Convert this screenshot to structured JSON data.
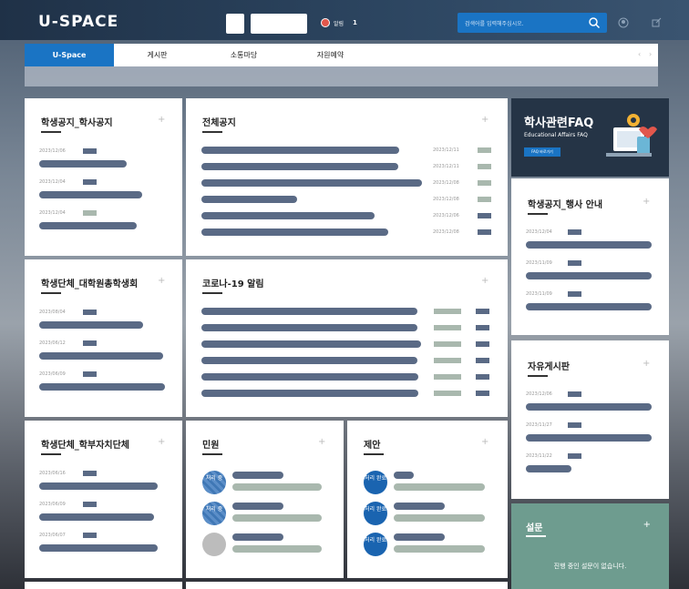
{
  "header": {
    "logo": "U-SPACE",
    "alarm_label": "알림",
    "alarm_count": "1",
    "search_placeholder": "검색어를 입력해주십시오."
  },
  "nav": {
    "tabs": [
      {
        "label": "U-Space",
        "active": true
      },
      {
        "label": "게시판",
        "active": false
      },
      {
        "label": "소통마당",
        "active": false
      },
      {
        "label": "자원예약",
        "active": false
      }
    ]
  },
  "panels": {
    "academic_notice": {
      "title": "학생공지_학사공지",
      "dates": [
        "2023/12/06",
        "2023/12/04",
        "2023/12/04"
      ]
    },
    "all_notice": {
      "title": "전체공지",
      "dates": [
        "2023/12/11",
        "2023/12/11",
        "2023/12/08",
        "2023/12/08",
        "2023/12/06",
        "2023/12/08"
      ]
    },
    "grad_council": {
      "title": "학생단체_대학원총학생회",
      "dates": [
        "2023/08/04",
        "2023/06/12",
        "2023/06/09"
      ]
    },
    "covid": {
      "title": "코로나-19 알림"
    },
    "undergrad_council": {
      "title": "학생단체_학부자치단체",
      "dates": [
        "2023/06/16",
        "2023/06/09",
        "2023/06/07"
      ]
    },
    "complaint": {
      "title": "민원",
      "status": [
        "처리 중",
        "처리 중"
      ]
    },
    "proposal": {
      "title": "제안",
      "status": [
        "처리 완료",
        "처리 완료",
        "처리 완료"
      ]
    },
    "faq": {
      "title": "학사관련FAQ",
      "subtitle": "Educational Affairs FAQ",
      "button": "FAQ 바로가기"
    },
    "event_notice": {
      "title": "학생공지_행사 안내",
      "dates": [
        "2023/12/04",
        "2023/11/09",
        "2023/11/09"
      ]
    },
    "free_board": {
      "title": "자유게시판",
      "dates": [
        "2023/12/06",
        "2023/11/27",
        "2023/11/22"
      ]
    },
    "survey": {
      "title": "설문",
      "message": "진행 중인 설문이 없습니다."
    }
  },
  "icons": {
    "search": "search-icon",
    "user": "user-icon",
    "logout": "logout-icon",
    "alarm": "bell-icon",
    "prev": "chevron-left-icon",
    "next": "chevron-right-icon"
  },
  "colors": {
    "brand_blue": "#1a74c4",
    "bar_dark": "#5a6a85",
    "bar_green": "#a9b8ae",
    "faq_bg": "#253446",
    "survey_bg": "#6e9c8f"
  }
}
